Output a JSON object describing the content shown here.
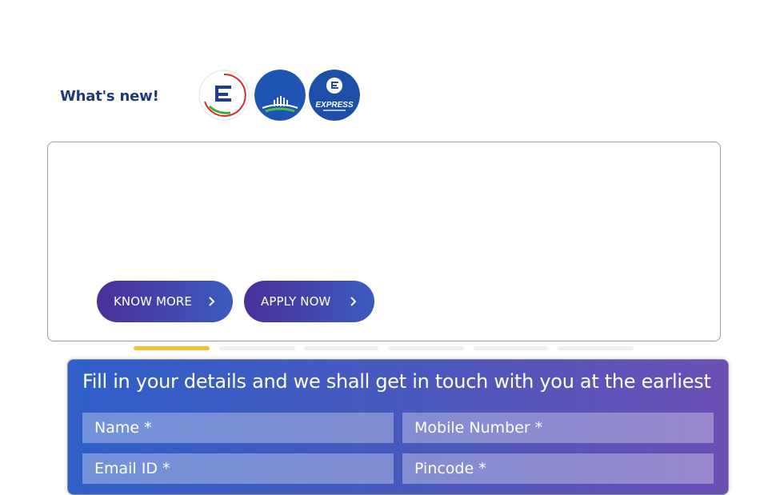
{
  "whats_new": {
    "title": "What's new!",
    "logos": [
      {
        "icon": "e-logo-circle-icon"
      },
      {
        "icon": "bridge-logo-icon"
      },
      {
        "icon": "express-logo-icon",
        "text": "EXPRESS"
      }
    ]
  },
  "banner": {
    "buttons": [
      {
        "label": "KNOW MORE"
      },
      {
        "label": "APPLY NOW"
      }
    ],
    "carousel_active_index": 0
  },
  "form": {
    "heading": "Fill in your details and we shall get in touch with you at the earliest",
    "fields": {
      "name_placeholder": "Name *",
      "mobile_placeholder": "Mobile Number *",
      "email_placeholder": "Email ID *",
      "pincode_placeholder": "Pincode *"
    }
  },
  "colors": {
    "brand_blue": "#1f3a7a",
    "accent_yellow": "#f2c230",
    "button_gradient_start": "#4a2f98",
    "button_gradient_end": "#3b5bbf"
  }
}
